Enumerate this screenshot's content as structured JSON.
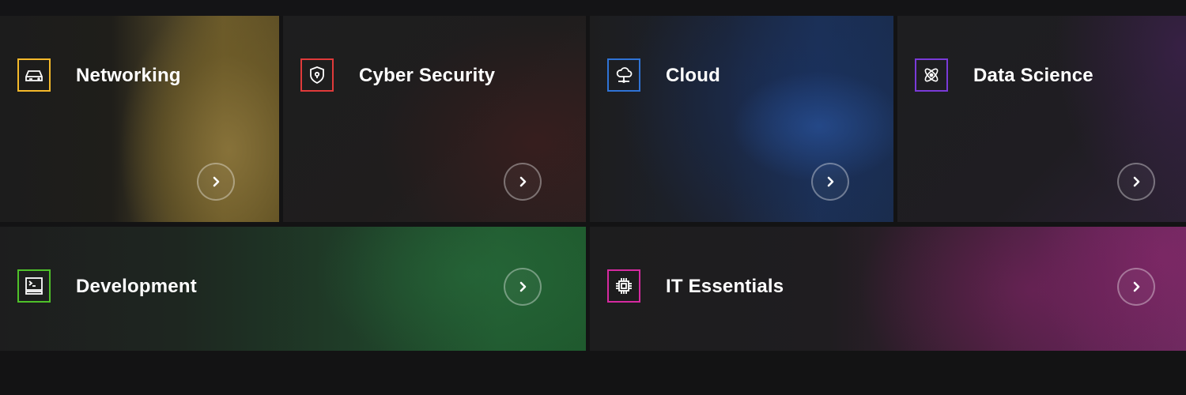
{
  "categories": [
    {
      "id": "networking",
      "label": "Networking",
      "accent": "#f5b92a",
      "icon": "router-icon"
    },
    {
      "id": "cyber",
      "label": "Cyber Security",
      "accent": "#e03a3a",
      "icon": "shield-lock-icon"
    },
    {
      "id": "cloud",
      "label": "Cloud",
      "accent": "#2f73d6",
      "icon": "cloud-network-icon"
    },
    {
      "id": "datasci",
      "label": "Data Science",
      "accent": "#7a3ad8",
      "icon": "atom-icon"
    },
    {
      "id": "dev",
      "label": "Development",
      "accent": "#4fc12a",
      "icon": "terminal-icon"
    },
    {
      "id": "it",
      "label": "IT Essentials",
      "accent": "#d62aa0",
      "icon": "chip-icon"
    }
  ],
  "arrow_icon": "chevron-right-icon"
}
